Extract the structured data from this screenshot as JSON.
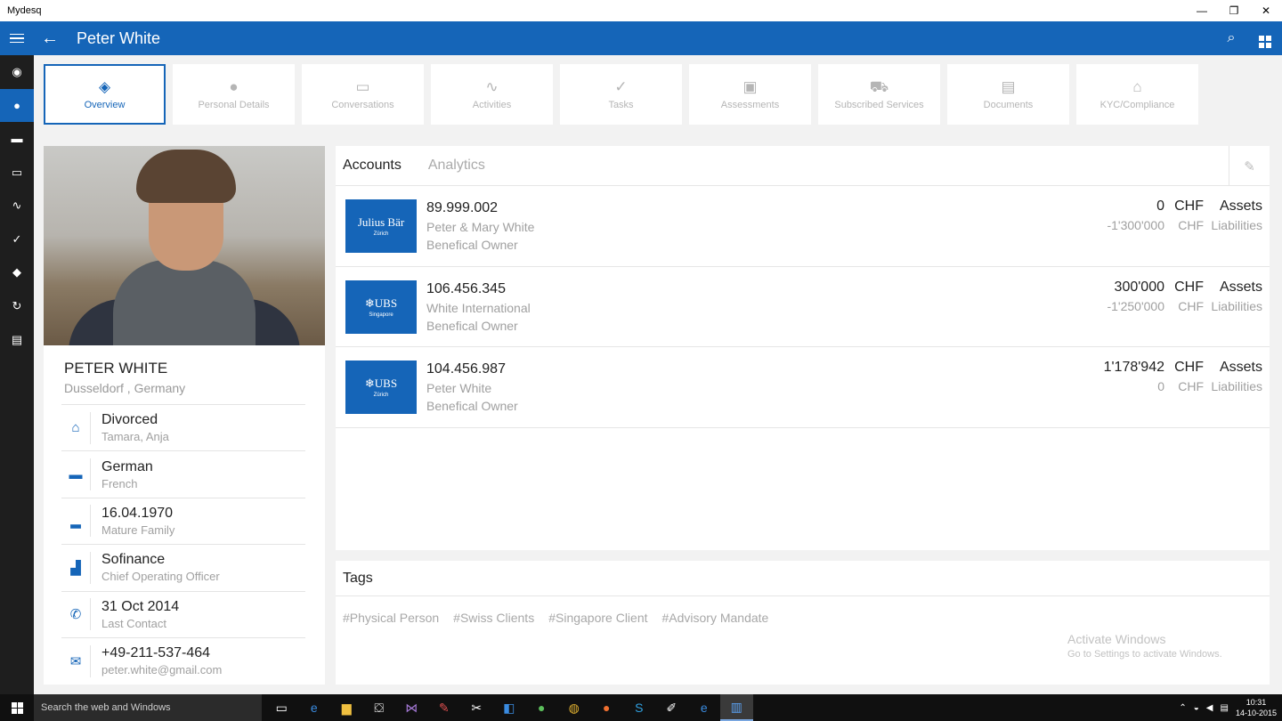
{
  "window": {
    "title": "Mydesq",
    "minimize_icon": "minimize-icon",
    "restore_icon": "restore-icon",
    "close_icon": "close-icon"
  },
  "appbar": {
    "title": "Peter White",
    "menu_icon": "hamburger-icon",
    "back_icon": "back-arrow-icon",
    "search_icon": "search-icon",
    "grid_icon": "grid-icon",
    "accent": "#1565b8"
  },
  "rail": {
    "items": [
      {
        "name": "dashboard-icon",
        "glyph": "◉"
      },
      {
        "name": "person-icon",
        "glyph": "👤",
        "active": true
      },
      {
        "name": "briefcase-icon",
        "glyph": "▬"
      },
      {
        "name": "chat-icon",
        "glyph": "▭"
      },
      {
        "name": "pulse-icon",
        "glyph": "∿"
      },
      {
        "name": "check-icon",
        "glyph": "✓"
      },
      {
        "name": "cube-icon",
        "glyph": "◆"
      },
      {
        "name": "refresh-icon",
        "glyph": "↻"
      },
      {
        "name": "documents-icon",
        "glyph": "▤"
      }
    ]
  },
  "tabs": [
    {
      "label": "Overview",
      "icon": "layers-icon",
      "glyph": "◈",
      "active": true
    },
    {
      "label": "Personal Details",
      "icon": "person-icon",
      "glyph": "●"
    },
    {
      "label": "Conversations",
      "icon": "chat-icon",
      "glyph": "▭"
    },
    {
      "label": "Activities",
      "icon": "pulse-icon",
      "glyph": "∿"
    },
    {
      "label": "Tasks",
      "icon": "check-icon",
      "glyph": "✓"
    },
    {
      "label": "Assessments",
      "icon": "chart-icon",
      "glyph": "▣"
    },
    {
      "label": "Subscribed Services",
      "icon": "cart-icon",
      "glyph": "⛟"
    },
    {
      "label": "Documents",
      "icon": "documents-icon",
      "glyph": "▤"
    },
    {
      "label": "KYC/Compliance",
      "icon": "bank-icon",
      "glyph": "⌂"
    }
  ],
  "profile": {
    "name": "PETER WHITE",
    "location": "Dusseldorf , Germany",
    "rows": [
      {
        "icon": "family-icon",
        "glyph": "⌂",
        "main": "Divorced",
        "sub": "Tamara, Anja"
      },
      {
        "icon": "speech-icon",
        "glyph": "▬",
        "main": "German",
        "sub": "French"
      },
      {
        "icon": "cake-icon",
        "glyph": "▂",
        "main": "16.04.1970",
        "sub": "Mature Family"
      },
      {
        "icon": "factory-icon",
        "glyph": "▟",
        "main": "Sofinance",
        "sub": "Chief Operating Officer"
      },
      {
        "icon": "phone-icon",
        "glyph": "✆",
        "main": "31 Oct 2014",
        "sub": "Last Contact"
      },
      {
        "icon": "mail-icon",
        "glyph": "✉",
        "main": "+49-211-537-464",
        "sub": "peter.white@gmail.com"
      }
    ]
  },
  "accounts": {
    "tabs": {
      "accounts": "Accounts",
      "analytics": "Analytics"
    },
    "edit_icon": "edit-icon",
    "rows": [
      {
        "bank": "Julius Bär",
        "city": "Zürich",
        "number": "89.999.002",
        "holder": "Peter & Mary White",
        "role": "Benefical Owner",
        "assets": "0",
        "liabilities": "-1'300'000",
        "currency": "CHF",
        "assets_label": "Assets",
        "liabilities_label": "Liabilities"
      },
      {
        "bank": "❄UBS",
        "city": "Singapore",
        "number": "106.456.345",
        "holder": "White International",
        "role": "Benefical Owner",
        "assets": "300'000",
        "liabilities": "-1'250'000",
        "currency": "CHF",
        "assets_label": "Assets",
        "liabilities_label": "Liabilities"
      },
      {
        "bank": "❄UBS",
        "city": "Zürich",
        "number": "104.456.987",
        "holder": "Peter White",
        "role": "Benefical Owner",
        "assets": "1'178'942",
        "liabilities": "0",
        "currency": "CHF",
        "assets_label": "Assets",
        "liabilities_label": "Liabilities"
      }
    ]
  },
  "tags": {
    "title": "Tags",
    "items": [
      "#Physical Person",
      "#Swiss Clients",
      "#Singapore Client",
      "#Advisory Mandate"
    ]
  },
  "watermark": {
    "line1": "Activate Windows",
    "line2": "Go to Settings to activate Windows."
  },
  "taskbar": {
    "search_placeholder": "Search the web and Windows",
    "apps": [
      "task-view-icon",
      "edge-icon",
      "file-explorer-icon",
      "store-icon",
      "visual-studio-icon",
      "paint-icon",
      "snipping-icon",
      "teamviewer-icon",
      "app-green-icon",
      "chrome-icon",
      "app-orange-icon",
      "skype-icon",
      "app-tool-icon",
      "ie-icon",
      "mydesq-icon"
    ],
    "time": "10:31",
    "date": "14-10-2015"
  }
}
